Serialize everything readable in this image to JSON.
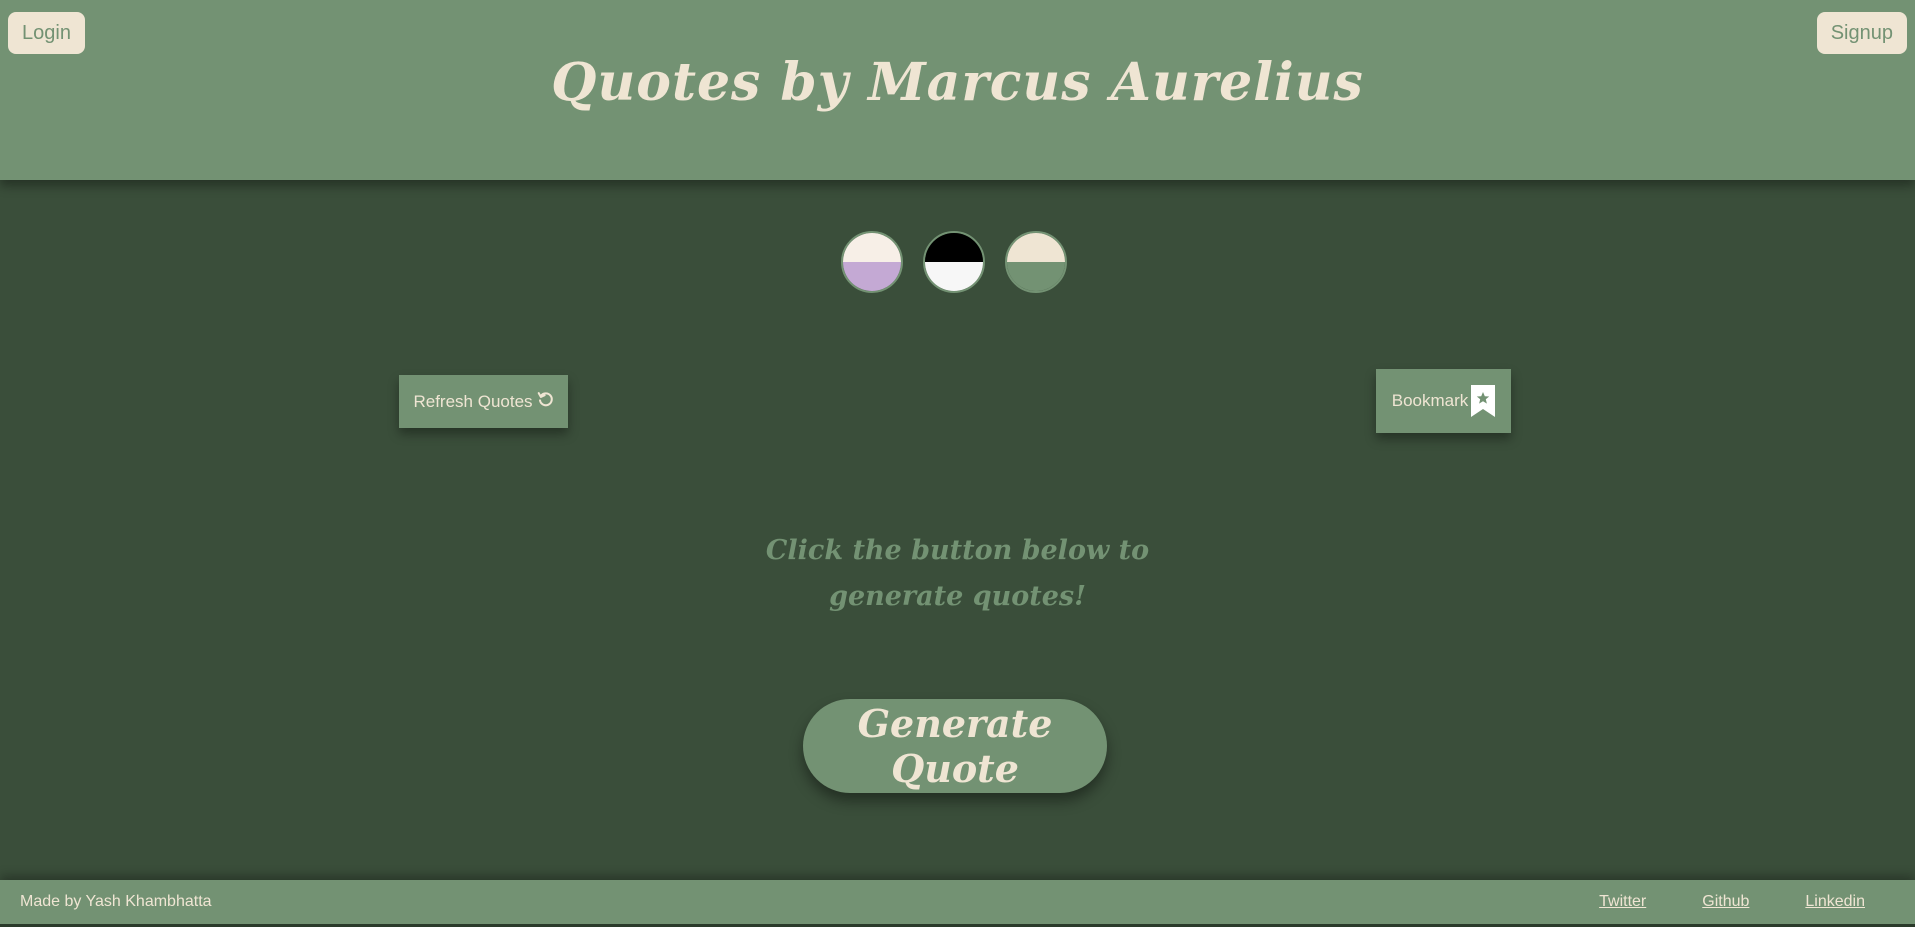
{
  "header": {
    "title": "Quotes by Marcus Aurelius",
    "login_label": "Login",
    "signup_label": "Signup"
  },
  "themes": [
    {
      "name": "lavender-theme",
      "top": "#f7efe7",
      "bottom": "#c4a9d4"
    },
    {
      "name": "monochrome-theme",
      "top": "#000000",
      "bottom": "#f7f7f7"
    },
    {
      "name": "sage-theme",
      "top": "#efe5d3",
      "bottom": "#739273"
    }
  ],
  "actions": {
    "refresh_label": "Refresh Quotes",
    "refresh_icon": "refresh-icon",
    "bookmark_label": "Bookmark",
    "bookmark_icon": "bookmark-star-icon"
  },
  "main": {
    "prompt": "Click the button below to generate quotes!",
    "generate_label": "Generate Quote"
  },
  "footer": {
    "credit": "Made by Yash Khambhatta",
    "links": [
      "Twitter",
      "Github",
      "Linkedin"
    ]
  },
  "colors": {
    "background": "#3a4e3a",
    "accent": "#739273",
    "cream": "#efe5d3"
  }
}
